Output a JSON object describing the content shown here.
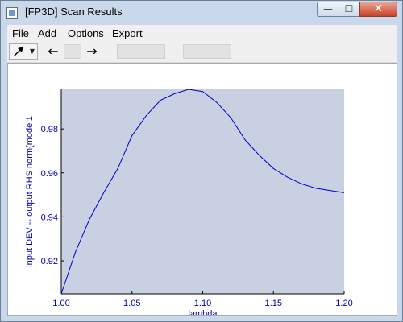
{
  "window": {
    "title": "[FP3D] Scan Results"
  },
  "title_controls": {
    "minimize": "—",
    "maximize": "☐",
    "close": "✕"
  },
  "menu": [
    {
      "label": "File"
    },
    {
      "label": "Add"
    },
    {
      "label": "Options"
    },
    {
      "label": "Export"
    }
  ],
  "toolbar": {
    "back_icon": "←",
    "forward_icon": "→",
    "pointer_icon": "pointer-arrow-icon"
  },
  "colors": {
    "plot_bg": "#c8d0e2",
    "series": "#0000cc",
    "axis_text": "#0000a8"
  },
  "chart_data": {
    "type": "line",
    "xlabel": "lambda",
    "ylabel": "input DEV -- output RHS norm(model1",
    "xlim": [
      1.0,
      1.2
    ],
    "ylim": [
      0.905,
      0.998
    ],
    "xticks": [
      "1.00",
      "1.05",
      "1.10",
      "1.15",
      "1.20"
    ],
    "yticks": [
      "0.92",
      "0.94",
      "0.96",
      "0.98"
    ],
    "xtick_values": [
      1.0,
      1.05,
      1.1,
      1.15,
      1.2
    ],
    "ytick_values": [
      0.92,
      0.94,
      0.96,
      0.98
    ],
    "series": [
      {
        "x": [
          1.0,
          1.01,
          1.02,
          1.03,
          1.04,
          1.05,
          1.06,
          1.07,
          1.08,
          1.09,
          1.1,
          1.11,
          1.12,
          1.13,
          1.14,
          1.15,
          1.16,
          1.17,
          1.18,
          1.19,
          1.2
        ],
        "y": [
          0.905,
          0.924,
          0.939,
          0.951,
          0.962,
          0.977,
          0.986,
          0.993,
          0.996,
          0.998,
          0.997,
          0.992,
          0.985,
          0.975,
          0.968,
          0.962,
          0.958,
          0.955,
          0.953,
          0.952,
          0.951
        ]
      }
    ]
  }
}
